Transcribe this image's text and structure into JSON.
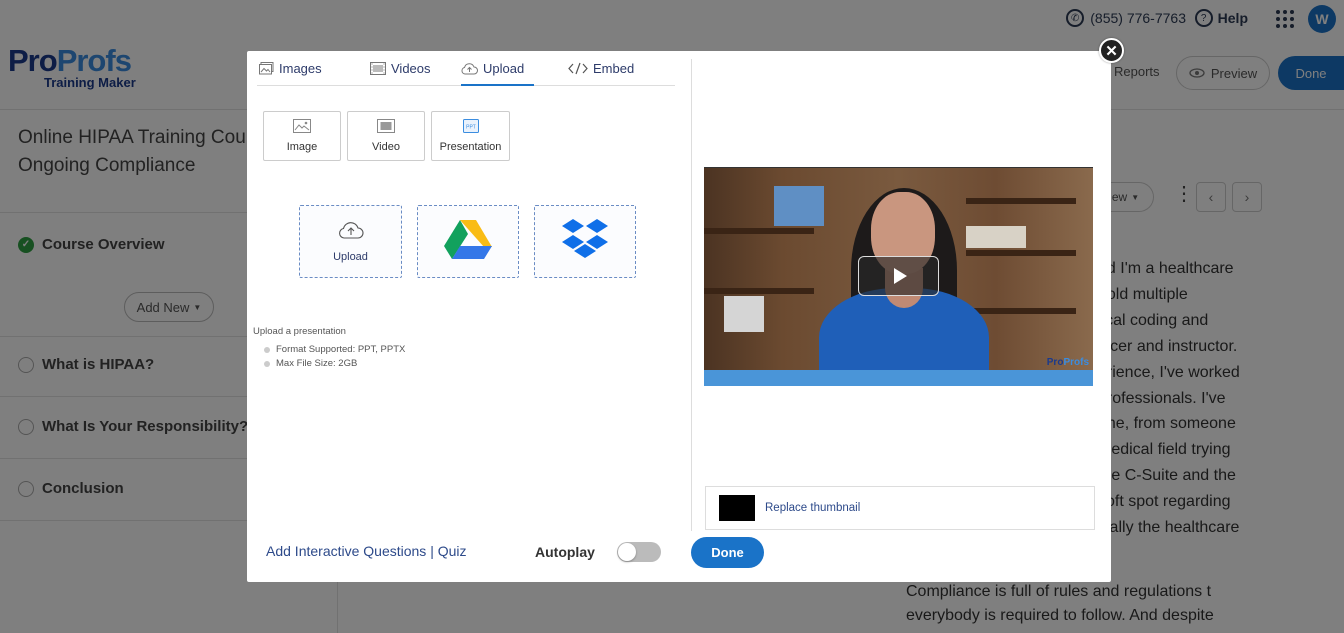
{
  "topbar": {
    "phone": "(855) 776-7763",
    "help": "Help",
    "avatar_letter": "W"
  },
  "header": {
    "logo_pro": "Pro",
    "logo_profs": "Profs",
    "logo_sub": "Training Maker",
    "reports": "Reports",
    "preview": "Preview",
    "done": "Done"
  },
  "sidebar": {
    "course_title_line1": "Online HIPAA Training Cours",
    "course_title_line2": "Ongoing Compliance",
    "overview": "Course Overview",
    "add_new": "Add New",
    "items": [
      "What is HIPAA?",
      "What Is Your Responsibility?",
      "Conclusion"
    ]
  },
  "content": {
    "view_pill": "ew",
    "article_lines": [
      "nd I'm a healthcare",
      "hold multiple",
      "lical coding and",
      "fficer and instructor.",
      "erience, I've worked",
      "professionals. I've",
      "one, from someone",
      "medical field trying",
      "the C-Suite and the",
      "soft spot regarding",
      "cially the healthcare"
    ],
    "article2_line1": "Compliance is full of rules and regulations t",
    "article2_line2": "everybody is required to follow. And despite"
  },
  "modal": {
    "tabs": [
      {
        "label": "Images",
        "icon": "image-icon"
      },
      {
        "label": "Videos",
        "icon": "video-icon"
      },
      {
        "label": "Upload",
        "icon": "cloud-upload-icon"
      },
      {
        "label": "Embed",
        "icon": "code-icon"
      }
    ],
    "active_tab": "Upload",
    "type_buttons": [
      "Image",
      "Video",
      "Presentation"
    ],
    "sources": {
      "upload_label": "Upload",
      "google_drive": "google-drive-icon",
      "dropbox": "dropbox-icon"
    },
    "upload_info": {
      "heading": "Upload a presentation",
      "format": "Format Supported: PPT, PPTX",
      "size": "Max File Size: 2GB"
    },
    "video": {
      "watermark_pro": "Pro",
      "watermark_profs": "Profs"
    },
    "replace_thumbnail": "Replace thumbnail",
    "add_questions": "Add Interactive Questions | Quiz",
    "autoplay_label": "Autoplay",
    "autoplay_on": false,
    "done": "Done"
  },
  "colors": {
    "accent": "#1a73c8",
    "brand_dark": "#1b3a8c",
    "brand_light": "#3b8de0",
    "link": "#2d4a8a"
  }
}
